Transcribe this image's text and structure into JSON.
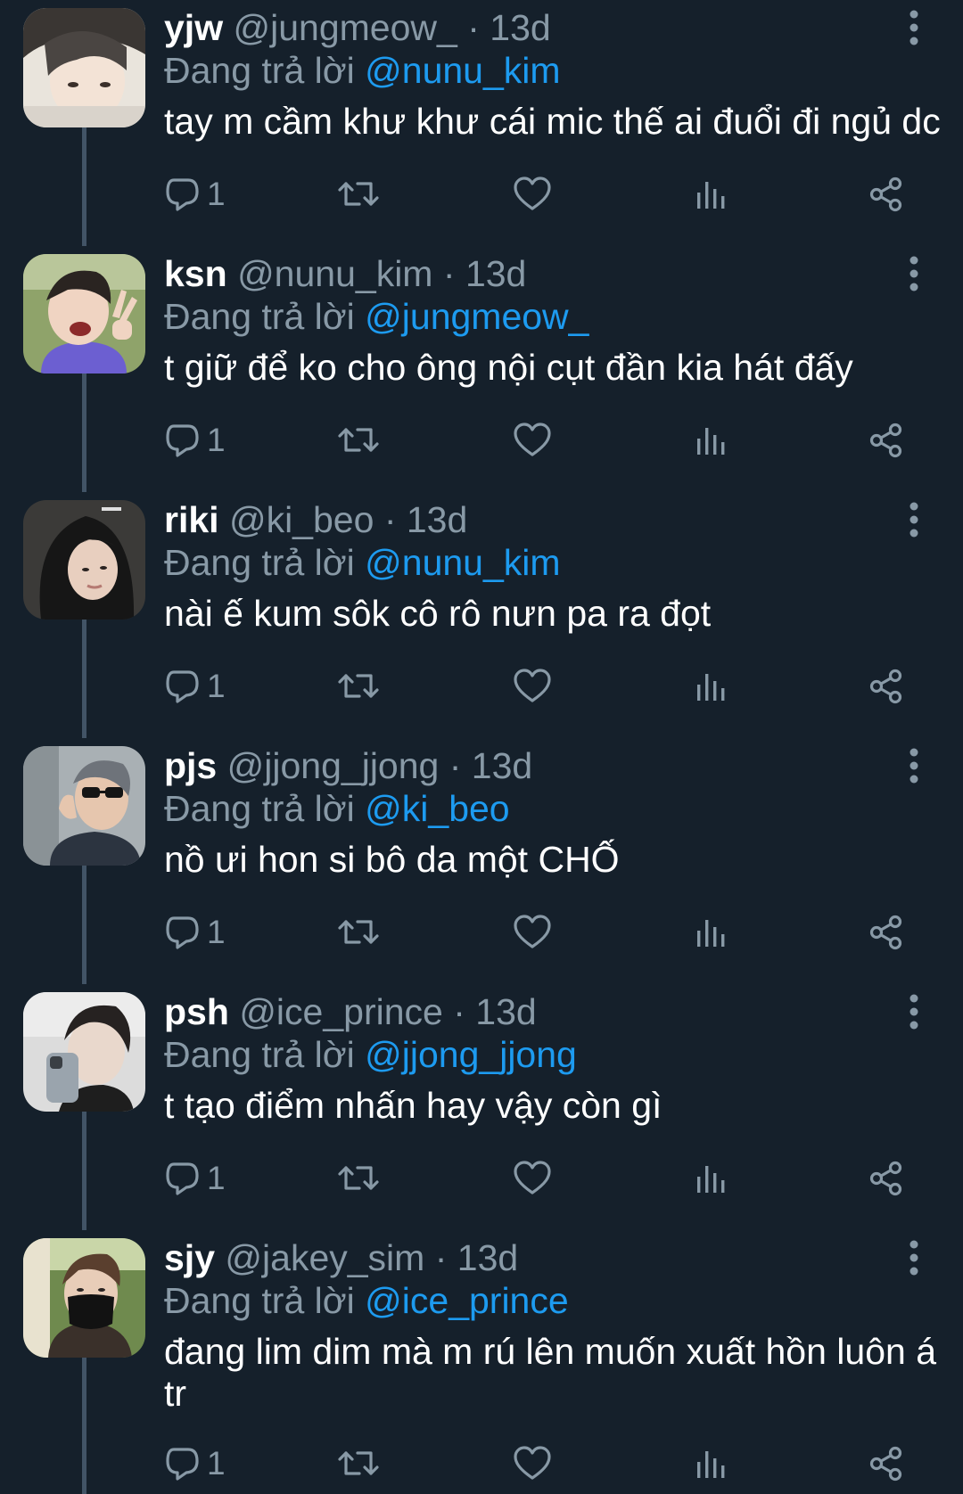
{
  "colors": {
    "background": "#15202b",
    "secondary_text": "#8899a6",
    "mention": "#1d9bf0",
    "thread_line": "#425466"
  },
  "icons": {
    "reply": "comment-bubble-icon",
    "retweet": "retweet-icon",
    "like": "heart-icon",
    "views": "analytics-bars-icon",
    "share": "share-icon",
    "more": "vertical-dots-icon"
  },
  "reply_prefix": "Đang trả lời",
  "tweets": [
    {
      "name": "yjw",
      "handle": "@jungmeow_",
      "time": "13d",
      "reply_to": "@nunu_kim",
      "text": "tay m cầm khư khư cái mic thế ai đuổi đi ngủ dc",
      "replies": "1"
    },
    {
      "name": "ksn",
      "handle": "@nunu_kim",
      "time": "13d",
      "reply_to": "@jungmeow_",
      "text": "t giữ để ko cho ông nội cụt đần kia hát đấy",
      "replies": "1"
    },
    {
      "name": "riki",
      "handle": "@ki_beo",
      "time": "13d",
      "reply_to": "@nunu_kim",
      "text": "nài ế kum sôk cô rô nưn pa ra đọt",
      "replies": "1"
    },
    {
      "name": "pjs",
      "handle": "@jjong_jjong",
      "time": "13d",
      "reply_to": "@ki_beo",
      "text": "nồ ưi hon si bô da một CHỐ",
      "replies": "1"
    },
    {
      "name": "psh",
      "handle": "@ice_prince",
      "time": "13d",
      "reply_to": "@jjong_jjong",
      "text": "t tạo điểm nhấn hay vậy còn gì",
      "replies": "1"
    },
    {
      "name": "sjy",
      "handle": "@jakey_sim",
      "time": "13d",
      "reply_to": "@ice_prince",
      "text": "đang lim dim mà m rú lên muốn xuất hồn luôn á tr",
      "replies": "1"
    }
  ]
}
